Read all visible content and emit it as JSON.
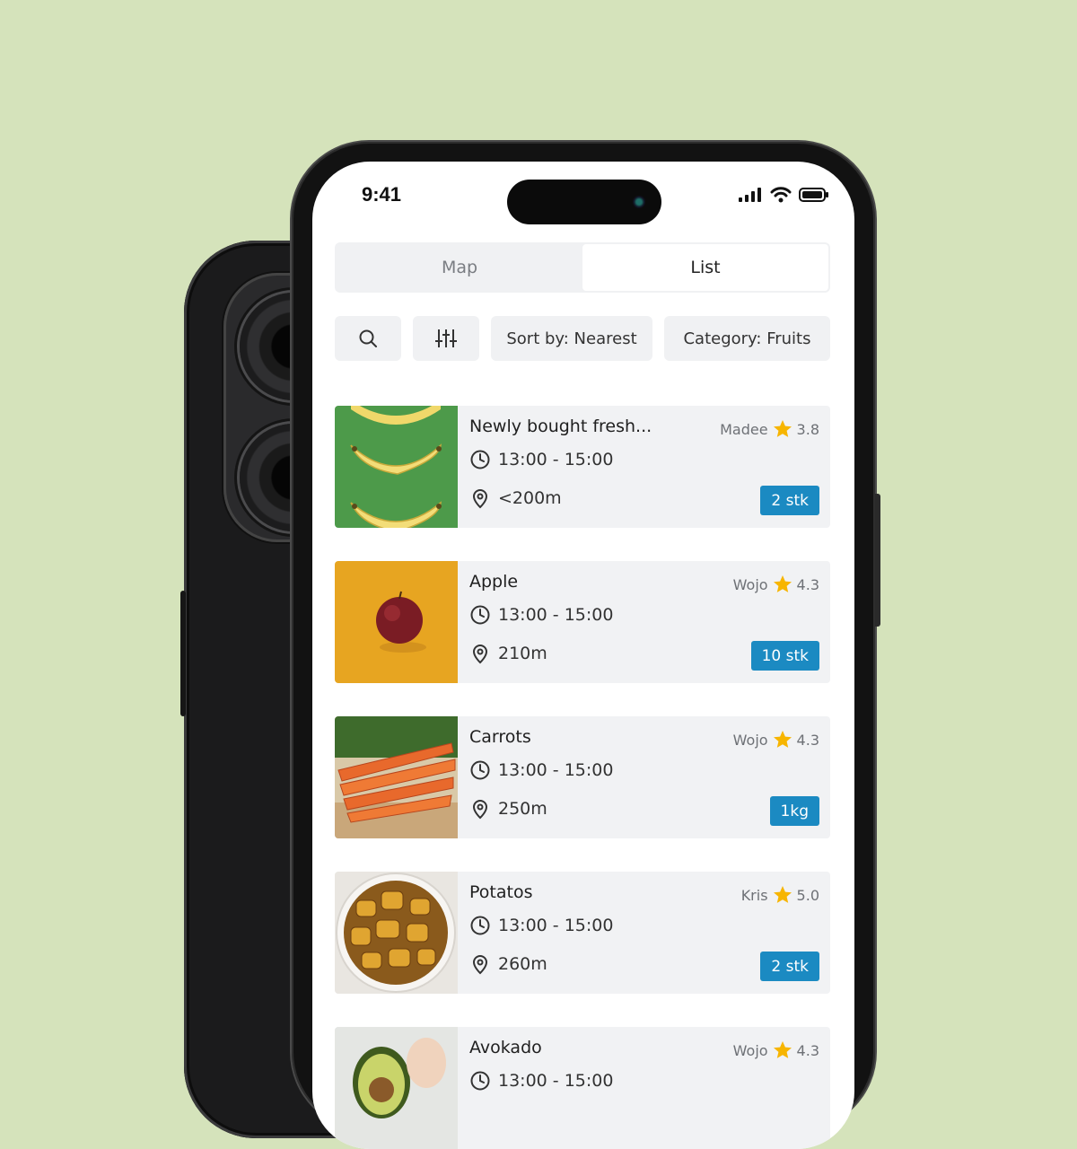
{
  "status": {
    "time": "9:41"
  },
  "tabs": [
    {
      "label": "Map",
      "active": false
    },
    {
      "label": "List",
      "active": true
    }
  ],
  "filters": {
    "sort_label": "Sort by:",
    "sort_value": "Nearest",
    "category_label": "Category:",
    "category_value": "Fruits"
  },
  "items": [
    {
      "title": "Newly bought fresh...",
      "seller": "Madee",
      "rating": "3.8",
      "time": "13:00 - 15:00",
      "distance": "<200m",
      "quantity": "2 stk",
      "image": "bananas"
    },
    {
      "title": "Apple",
      "seller": "Wojo",
      "rating": "4.3",
      "time": "13:00 - 15:00",
      "distance": "210m",
      "quantity": "10 stk",
      "image": "apple"
    },
    {
      "title": "Carrots",
      "seller": "Wojo",
      "rating": "4.3",
      "time": "13:00 - 15:00",
      "distance": "250m",
      "quantity": "1kg",
      "image": "carrots"
    },
    {
      "title": "Potatos",
      "seller": "Kris",
      "rating": "5.0",
      "time": "13:00 - 15:00",
      "distance": "260m",
      "quantity": "2 stk",
      "image": "potatoes"
    },
    {
      "title": "Avokado",
      "seller": "Wojo",
      "rating": "4.3",
      "time": "13:00 - 15:00",
      "distance": "",
      "quantity": "",
      "image": "avocado"
    }
  ],
  "colors": {
    "accent": "#1b8ac2",
    "star": "#f7b500",
    "background": "#d5e3bb"
  }
}
